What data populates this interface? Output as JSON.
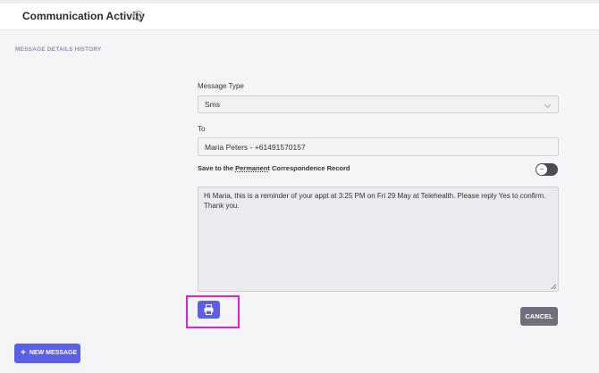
{
  "header": {
    "title": "Communication Activity",
    "info_icon": "info-icon"
  },
  "section": {
    "label": "MESSAGE DETAILS HISTORY"
  },
  "form": {
    "message_type_label": "Message Type",
    "message_type_value": "Sms",
    "to_label": "To",
    "to_value": "Maria Peters - +61491570157",
    "save_label_prefix": "Save to the ",
    "save_label_link": "Permanent",
    "save_label_suffix": " Correspondence Record",
    "save_toggle_on": false,
    "message_text": "Hi Maria, this is a reminder of your appt at 3:25 PM on Fri 29 May at Telehealth. Please reply Yes to confirm. Thank you."
  },
  "actions": {
    "print_icon": "print-icon",
    "cancel_label": "CANCEL",
    "new_message_label": "NEW MESSAGE",
    "new_message_icon": "plus-icon"
  },
  "colors": {
    "accent": "#5b5fe8",
    "cancel": "#6e717a",
    "highlight": "#e020d8",
    "toggle": "#4a4d55"
  }
}
